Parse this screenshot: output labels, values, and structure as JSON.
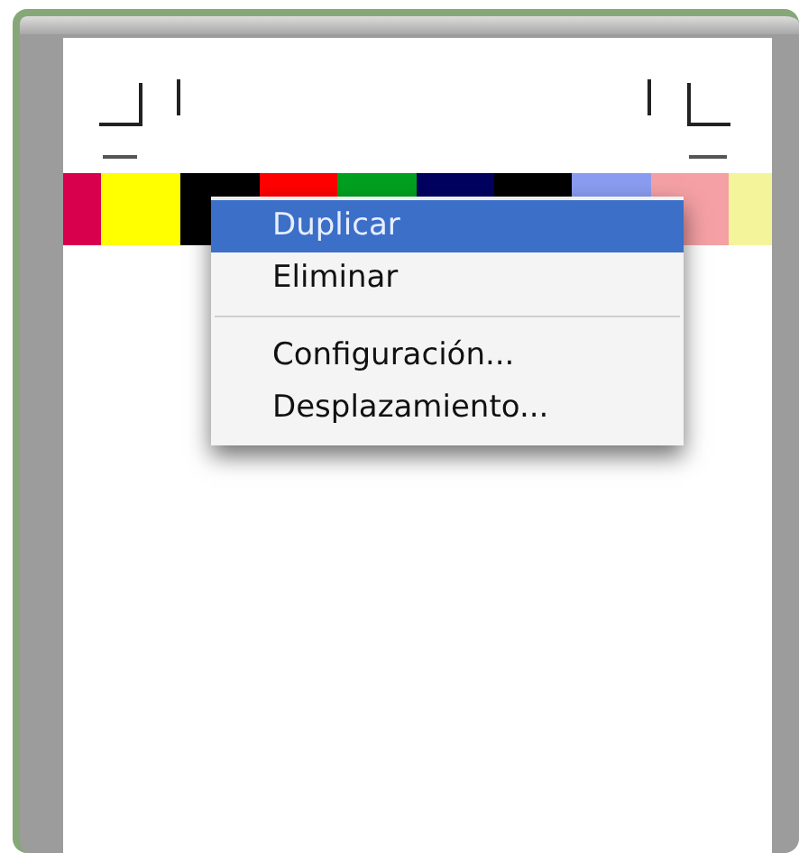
{
  "context_menu": {
    "items": [
      {
        "kind": "item",
        "label": "Duplicar",
        "selected": true
      },
      {
        "kind": "item",
        "label": "Eliminar",
        "selected": false
      },
      {
        "kind": "separator"
      },
      {
        "kind": "item",
        "label": "Configuración...",
        "selected": false
      },
      {
        "kind": "item",
        "label": "Desplazamiento...",
        "selected": false
      }
    ]
  }
}
